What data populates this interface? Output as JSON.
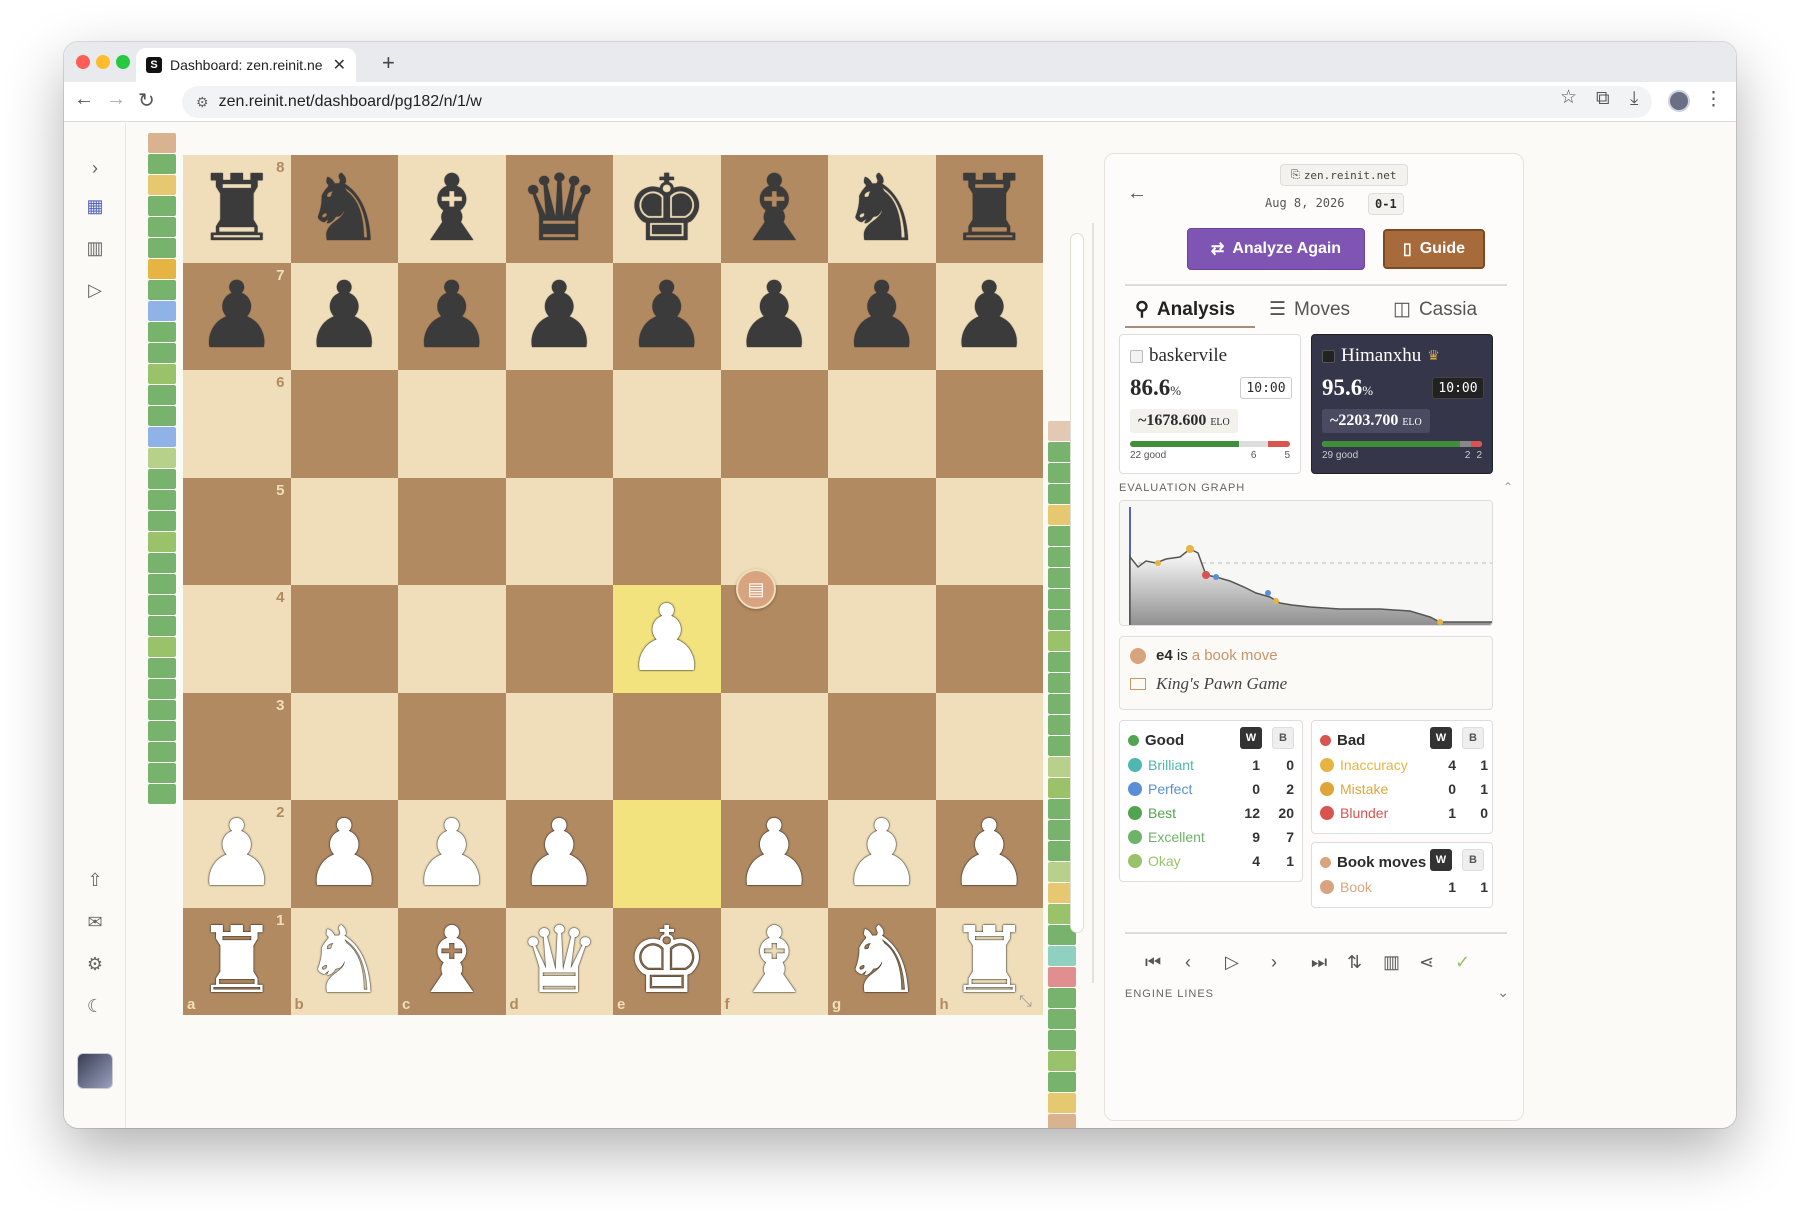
{
  "browser": {
    "tab_title": "Dashboard: zen.reinit.ne",
    "url": "zen.reinit.net/dashboard/pg182/n/1/w",
    "new_tab": "+"
  },
  "board": {
    "ranks": [
      "8",
      "7",
      "6",
      "5",
      "4",
      "3",
      "2",
      "1"
    ],
    "files": [
      "a",
      "b",
      "c",
      "d",
      "e",
      "f",
      "g",
      "h"
    ],
    "position": [
      [
        "bR",
        "bN",
        "bB",
        "bQ",
        "bK",
        "bB",
        "bN",
        "bR"
      ],
      [
        "bP",
        "bP",
        "bP",
        "bP",
        "bP",
        "bP",
        "bP",
        "bP"
      ],
      [
        "",
        "",
        "",
        "",
        "",
        "",
        "",
        ""
      ],
      [
        "",
        "",
        "",
        "",
        "",
        "",
        "",
        ""
      ],
      [
        "",
        "",
        "",
        "",
        "wP",
        "",
        "",
        ""
      ],
      [
        "",
        "",
        "",
        "",
        "",
        "",
        "",
        ""
      ],
      [
        "wP",
        "wP",
        "wP",
        "wP",
        "",
        "wP",
        "wP",
        "wP"
      ],
      [
        "wR",
        "wN",
        "wB",
        "wQ",
        "wK",
        "wB",
        "wN",
        "wR"
      ]
    ],
    "highlighted": [
      "e4",
      "e2"
    ],
    "last_move_badge_icon": "book-icon"
  },
  "panel": {
    "site_pill": "zen.reinit.net",
    "date": "Aug 8, 2026",
    "result": "0-1",
    "analyze_again": "Analyze Again",
    "guide": "Guide",
    "tabs": [
      "Analysis",
      "Moves",
      "Cassia"
    ],
    "players": {
      "white": {
        "name": "baskervile",
        "accuracy": "86.6",
        "pct": "%",
        "clock": "10:00",
        "elo": "~1678.600",
        "elo_unit": "ELO",
        "good": "22 good",
        "mid": "6",
        "bad": "5"
      },
      "black": {
        "name": "Himanxhu",
        "accuracy": "95.6",
        "pct": "%",
        "clock": "10:00",
        "elo": "~2203.700",
        "elo_unit": "ELO",
        "good": "29 good",
        "mid": "2",
        "bad": "2"
      }
    },
    "eval_label": "EVALUATION GRAPH",
    "book": {
      "move": "e4",
      "is": "is",
      "link": "a book move",
      "opening": "King's Pawn Game"
    },
    "good": {
      "title": "Good",
      "w": "W",
      "b": "B",
      "rows": [
        {
          "label": "Brilliant",
          "w": "1",
          "b": "0",
          "color": "#4fb6b0"
        },
        {
          "label": "Perfect",
          "w": "0",
          "b": "2",
          "color": "#5a8fd8"
        },
        {
          "label": "Best",
          "w": "12",
          "b": "20",
          "color": "#53a451"
        },
        {
          "label": "Excellent",
          "w": "9",
          "b": "7",
          "color": "#6fb36a"
        },
        {
          "label": "Okay",
          "w": "4",
          "b": "1",
          "color": "#9ac26a"
        }
      ]
    },
    "bad": {
      "title": "Bad",
      "w": "W",
      "b": "B",
      "rows": [
        {
          "label": "Inaccuracy",
          "w": "4",
          "b": "1",
          "color": "#e6b443"
        },
        {
          "label": "Mistake",
          "w": "0",
          "b": "1",
          "color": "#e0a53a"
        },
        {
          "label": "Blunder",
          "w": "1",
          "b": "0",
          "color": "#d9534f"
        }
      ]
    },
    "bookmoves": {
      "title": "Book moves",
      "w": "W",
      "b": "B",
      "row": {
        "label": "Book",
        "w": "1",
        "b": "1",
        "color": "#d8a47f"
      }
    },
    "engine_lines": "ENGINE LINES"
  },
  "colors": {
    "accent": "#7e55b3",
    "guide": "#a76a3a",
    "light_square": "#efdeb9",
    "dark_square": "#b28a61",
    "highlight": "#f2e37f"
  }
}
